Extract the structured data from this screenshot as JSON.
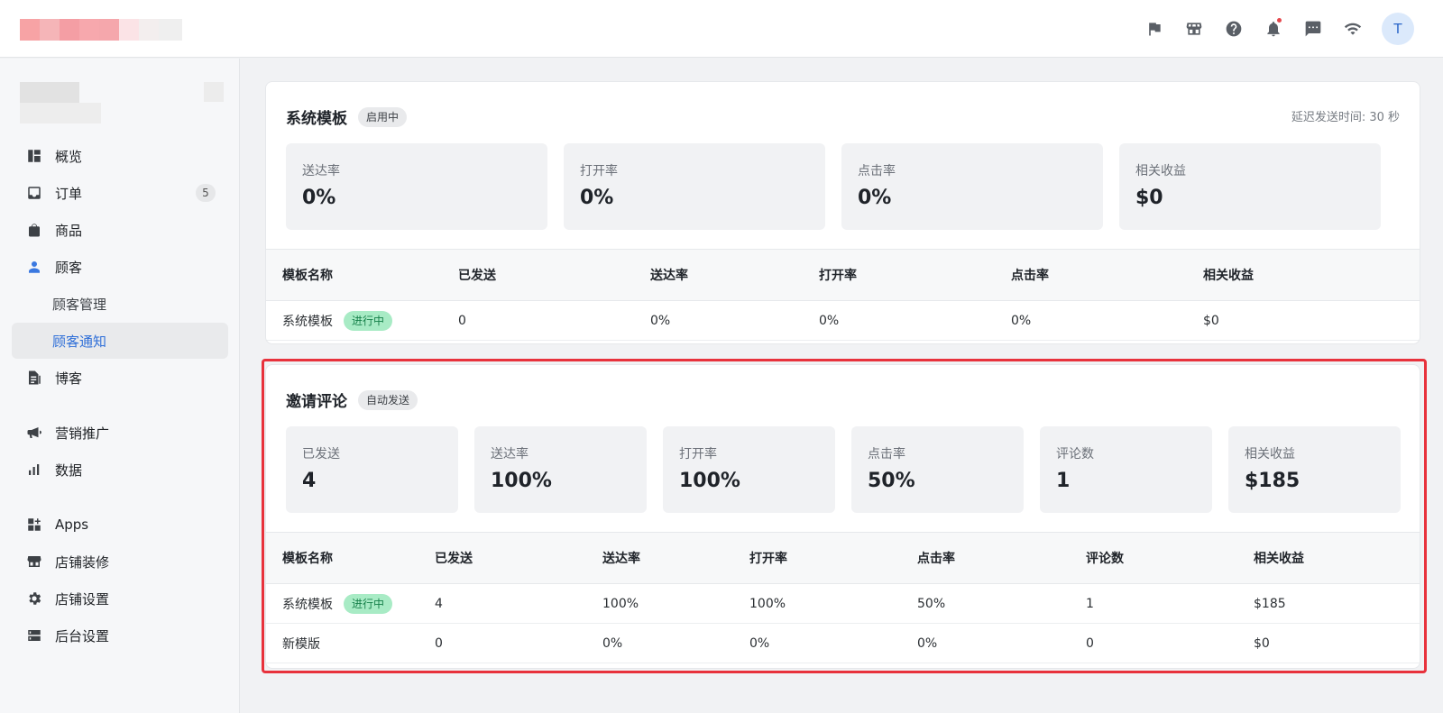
{
  "topbar": {
    "icons": [
      "flag-icon",
      "store-icon",
      "help-icon",
      "bell-icon",
      "chat-icon",
      "wifi-icon"
    ],
    "avatar_initial": "T"
  },
  "sidebar": {
    "items": [
      {
        "label": "概览",
        "icon": "dashboard-icon"
      },
      {
        "label": "订单",
        "icon": "inbox-icon",
        "count": "5"
      },
      {
        "label": "商品",
        "icon": "shopping-bag-icon"
      },
      {
        "label": "顾客",
        "icon": "person-icon"
      },
      {
        "label": "顾客管理"
      },
      {
        "label": "顾客通知"
      },
      {
        "label": "博客",
        "icon": "blog-icon"
      },
      {
        "label": "营销推广",
        "icon": "megaphone-icon"
      },
      {
        "label": "数据",
        "icon": "bar-chart-icon"
      },
      {
        "label": "Apps",
        "icon": "apps-icon"
      },
      {
        "label": "店铺装修",
        "icon": "store-icon"
      },
      {
        "label": "店铺设置",
        "icon": "gear-icon"
      },
      {
        "label": "后台设置",
        "icon": "server-icon"
      }
    ]
  },
  "system_template": {
    "title": "系统模板",
    "tag": "启用中",
    "delay": "延迟发送时间: 30 秒",
    "stats": [
      {
        "label": "送达率",
        "value": "0%"
      },
      {
        "label": "打开率",
        "value": "0%"
      },
      {
        "label": "点击率",
        "value": "0%"
      },
      {
        "label": "相关收益",
        "value": "$0"
      }
    ],
    "table": {
      "headers": [
        "模板名称",
        "已发送",
        "送达率",
        "打开率",
        "点击率",
        "相关收益"
      ],
      "rows": [
        {
          "name": "系统模板",
          "status": "进行中",
          "cells": [
            "0",
            "0%",
            "0%",
            "0%",
            "$0"
          ]
        }
      ]
    }
  },
  "review_invite": {
    "title": "邀请评论",
    "tag": "自动发送",
    "stats": [
      {
        "label": "已发送",
        "value": "4"
      },
      {
        "label": "送达率",
        "value": "100%"
      },
      {
        "label": "打开率",
        "value": "100%"
      },
      {
        "label": "点击率",
        "value": "50%"
      },
      {
        "label": "评论数",
        "value": "1"
      },
      {
        "label": "相关收益",
        "value": "$185"
      }
    ],
    "table": {
      "headers": [
        "模板名称",
        "已发送",
        "送达率",
        "打开率",
        "点击率",
        "评论数",
        "相关收益"
      ],
      "rows": [
        {
          "name": "系统模板",
          "status": "进行中",
          "cells": [
            "4",
            "100%",
            "100%",
            "50%",
            "1",
            "$185"
          ]
        },
        {
          "name": "新模版",
          "status": "",
          "cells": [
            "0",
            "0%",
            "0%",
            "0%",
            "0",
            "$0"
          ]
        }
      ]
    }
  },
  "colors": {
    "accent": "#2f6fd8",
    "highlight_border": "#e8323c",
    "status_green_bg": "#a8ebc5"
  }
}
